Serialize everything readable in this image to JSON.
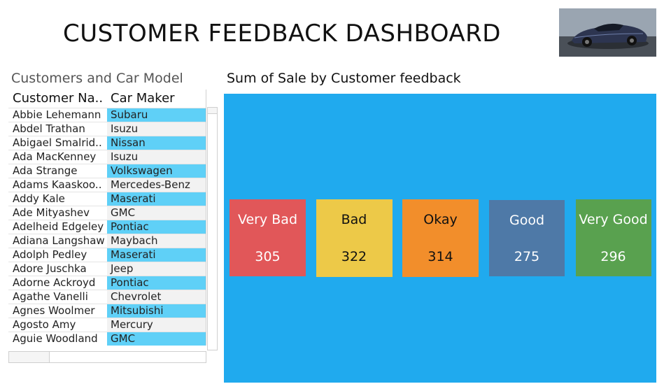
{
  "header": {
    "title": "CUSTOMER FEEDBACK DASHBOARD",
    "image_icon": "sports-car-photo"
  },
  "table": {
    "title": "Customers and Car Model",
    "columns": [
      "Customer Na..",
      "Car Maker"
    ],
    "rows": [
      {
        "name": "Abbie Lehemann",
        "maker": "Subaru",
        "highlight": true
      },
      {
        "name": "Abdel Trathan",
        "maker": "Isuzu",
        "highlight": false
      },
      {
        "name": "Abigael Smalrid..",
        "maker": "Nissan",
        "highlight": true
      },
      {
        "name": "Ada MacKenney",
        "maker": "Isuzu",
        "highlight": false
      },
      {
        "name": "Ada Strange",
        "maker": "Volkswagen",
        "highlight": true
      },
      {
        "name": "Adams Kaaskoo..",
        "maker": "Mercedes-Benz",
        "highlight": false
      },
      {
        "name": "Addy Kale",
        "maker": "Maserati",
        "highlight": true
      },
      {
        "name": "Ade Mityashev",
        "maker": "GMC",
        "highlight": false
      },
      {
        "name": "Adelheid Edgeley",
        "maker": "Pontiac",
        "highlight": true
      },
      {
        "name": "Adiana Langshaw",
        "maker": "Maybach",
        "highlight": false
      },
      {
        "name": "Adolph Pedley",
        "maker": "Maserati",
        "highlight": true
      },
      {
        "name": "Adore Juschka",
        "maker": "Jeep",
        "highlight": false
      },
      {
        "name": "Adorne Ackroyd",
        "maker": "Pontiac",
        "highlight": true
      },
      {
        "name": "Agathe Vanelli",
        "maker": "Chevrolet",
        "highlight": false
      },
      {
        "name": "Agnes Woolmer",
        "maker": "Mitsubishi",
        "highlight": true
      },
      {
        "name": "Agosto Amy",
        "maker": "Mercury",
        "highlight": false
      },
      {
        "name": "Aguie Woodland",
        "maker": "GMC",
        "highlight": true
      }
    ],
    "highlight_color": "#5fd0f7"
  },
  "chart_data": {
    "type": "bar",
    "title": "Sum of Sale by Customer feedback",
    "categories": [
      "Very Bad",
      "Bad",
      "Okay",
      "Good",
      "Very Good"
    ],
    "values": [
      305,
      322,
      314,
      275,
      296
    ],
    "colors": [
      "#e15759",
      "#edc948",
      "#f28e2b",
      "#4e79a7",
      "#59a14f"
    ],
    "text_colors": [
      "#ffffff",
      "#111111",
      "#111111",
      "#ffffff",
      "#ffffff"
    ],
    "background": "#20aaee",
    "legend": "none",
    "grid": false
  }
}
